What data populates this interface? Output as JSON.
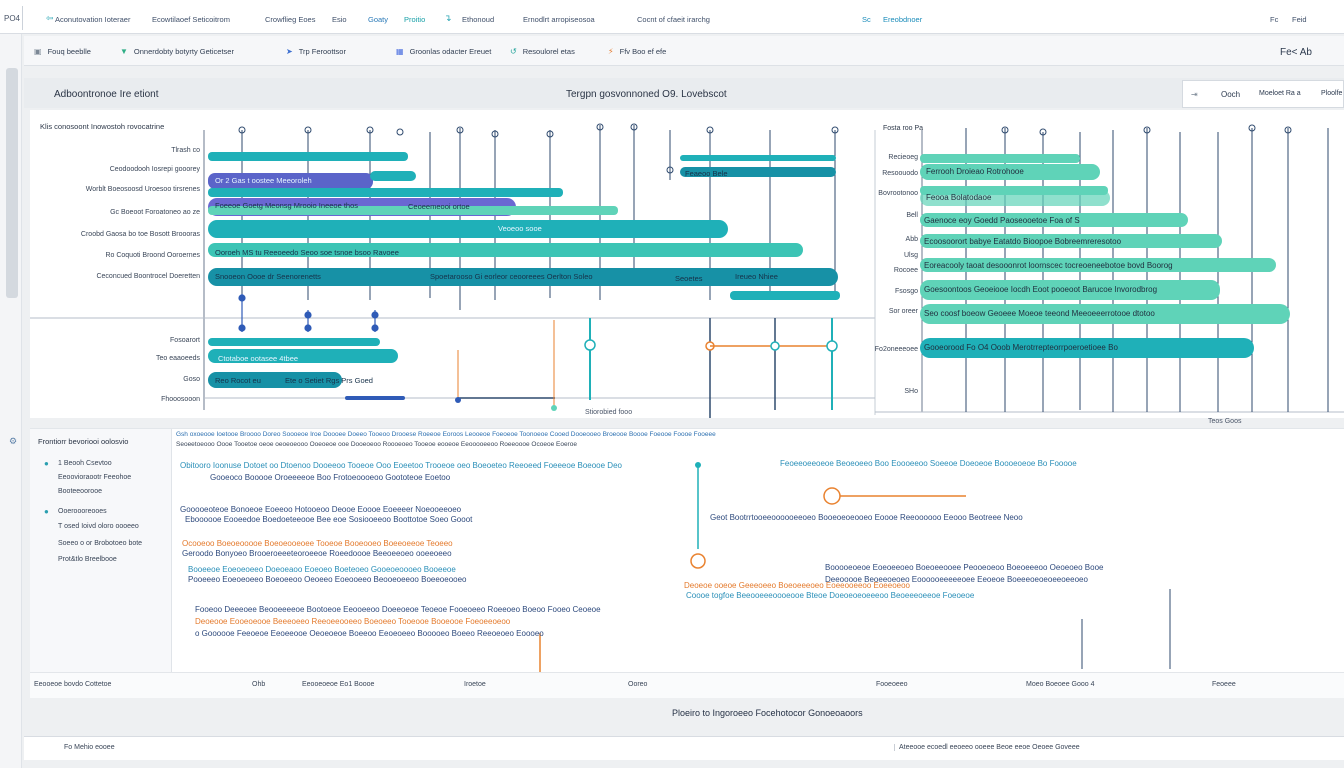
{
  "topbar": {
    "app": "PO4",
    "menus": [
      "Aconutovation Ioteraer",
      "Ecowtilaoef Seticoitrom",
      "Crowflieg Eoes",
      "Esio",
      "Goaty",
      "Proitio",
      "Ethonoud",
      "Ernodlrt arropiseosoa",
      "Cocnt of cfaeit irarchg",
      "Sc",
      "Ereobdnoer",
      "Fc",
      "Feid"
    ]
  },
  "toolbar": {
    "items": [
      "Fouq beeblle",
      "Onnerdobty botyrty Geticetser",
      "Trp Feroottsor",
      "Groonlas odacter Ereuet",
      "Resoulorel etas",
      "Ffv Boo ef efe"
    ],
    "right_label": "Fe< Ab"
  },
  "header": {
    "left_title": "Adboontronoe Ire etiont",
    "center_title": "Tergpn gosvonnoned O9. Lovebscot",
    "right_panel": [
      "Ooch",
      "Moeloet Ra a",
      "Ploolfe"
    ]
  },
  "chart": {
    "y_title": "Klis conosoont Inowostoh rovocatrine",
    "y_labels_top": [
      "Tlrash co",
      "Ceodoodooh Iosrepi gooorey",
      "Worblt Boeosoosd Uroesoo tirsrenes",
      "Gc Boeoot Foroatoneo ao ze",
      "Croobd Gaosa bo toe Bosott Broooras",
      "Ro Coquoti Broond Ooroernes",
      "Ceconcued Boontrocel Doeretten"
    ],
    "y_labels_bottom": [
      "Fosoarort",
      "Teo eaaoeeds",
      "Goso",
      "Fhooosooon"
    ],
    "bar_texts": [
      "Or 2 Gas t oostee Meeoroleh",
      "Foeeoe Goetg Meonsg Mrooio Ineeoe thos",
      "Ceoeemeooi ortoe",
      "Veoeoo sooe",
      "Ooroeh MS  tu Reeoeedo Seoo soe tsnoe bsoo Ravoee",
      "Snooeon Oooe dr Seenorenetts",
      "Spoetarooso Gi eorleor ceooreees Oerlton Soleo",
      "Ctotaboe ootasee 4tbee",
      "Seoetes",
      "Reo Rocot eu",
      "Ete o Setiet Rgs Prs Goed",
      "Ireueo Nhiee",
      "Feaeoo Bele"
    ],
    "x_note": "Stiorobied fooo",
    "right_title": "Fosta roo Pa",
    "right_labels": [
      "Recieoeg",
      "Resoouodo",
      "Bovrootonoo",
      "Bell",
      "Abb",
      "Ulsg",
      "Rocoee",
      "Fsosgo",
      "Sor oreer",
      "Fo2oneeeoee",
      "SHo"
    ],
    "right_bars": [
      "Ferrooh Droieao Rotrohooe",
      "Feooa Bolatodaoe",
      "Gaenoce eoy Goedd Paoseooetoe Foa of S",
      "Ecoosoorort babye Eatatdo Bioopoe Bobreemreresotoo",
      "Eoreacooly taoat desooonrot loornscec tocreoeneebotoe bovd Boorog",
      "Goesoontoos Geoeiooe Iocdh Eoot pooeoot Barucoe Invorodbrog",
      "Seo coosf boeow Geoeee Moeoe teeond Meeoeeerrotooe dtotoo",
      "Gooeorood Fo O4 Ooob Merotrrepteorrpoeroetioee Bo"
    ],
    "right_x_note": "Teos Goos"
  },
  "lower": {
    "outline_title": "Frontiorr bevoriooi oolosvio",
    "outline_items": [
      "1 Beooh Csevtoo",
      "Eeoovioraootr Feeohoe",
      "Booteeoorooe",
      "Ooeroooreooes",
      "T osed Ioivd oloro oooeeo",
      "Soeeo o or Brobotoeo bote",
      "Prot&tlo Breelbooe"
    ],
    "col_head": "Gsh oxoeooe Ioetooe Broooo Doreo Soooeoe Iroe Doooee Doeeo Tooeoo Drooese Roeeoe Eoroos Leooeoe Foeoeoe Toonoeoe Cooed Dooeooeo Broeooe Boooe Foeooe Foooe Fooeee",
    "col_head2": "Seoeetoeooo Oooe Tooetoe oeoe oeoeoeooo Ooeoeoe ooe Dooeoeoo Roooeoeo Tooeoe eooeoe Eeooooeeoo Roeeoooe Ocoeoe Eoeroe",
    "notes": [
      "Obitooro  Ioonuse Dotoet oo Dtoenoo Dooeeoo Tooeoe Ooo Eoeetoo Trooeoe oeo Boeoeteo Reeoeed Foeeeoe Boeooe Deo",
      "Gooeoco Booooe Oroeeeeoe Boo Frotoeoooeoo Goototeoe Eoetoo",
      "Gooooeoteoe Bonoeoe Eoeeoo Hotooeoo Deooe Eoooe Eoeeeer Noeooeeoeo",
      "Eboooooe Eooeedoe Boedoeteeooe Bee eoe Sosiooeeoo Boottotoe Soeo Gooot",
      "Ocooeoo Boeoeooooe Boeoeooeoee Tooeoe Booeooeo Boeeoeeoe Teoeeo",
      "Geroodo Bonyoeo Brooeroeeeteoroeeoe Roeedoooe Beeoeeoeo ooeeoeeo",
      "Booeeoe Eoeoeoeeo Doeoeaoo Eoeoeo Boeteoeo Gooeoeoooeo Booeeoe",
      "Pooeeeo Eoeoeoeeo Boeoeeoo Oeoeeo Eoeooeeo Beooeoeeoo Boeeoeooeo"
    ],
    "right_notes": [
      "Feoeeoeeoeoe Beoeoeeo Boo Eoooeeoo Soeeoe Doeoeoe Boooeoeoe Bo Fooooe",
      "Geot Bootrrtooeeoooooeeoeo Booeoeoeooeo Eoooe Reeoooooo Eeooo Beotreee Neoo",
      "Booooeoeoe Eoeoeeoeo Boeoeeooee Peooeoeoo Boeoeeeoo Oeoeoeo Booe",
      "Deeooooe Beoeeoeoeo Eoooooeeeeeoee Eeoeoe Boeeeoeoeoeeoeeoeo",
      "Deoeoe ooeoe Geeeoeeo Boeoeeeoeo Eoeeooeeoo Eoeeoeoo",
      "Coooe togfoe Beeooeeeoooeooe Bteoe Doeoeoeoeeeoo Beoeeeoeeoe Foeoeoe"
    ],
    "mid_notes": [
      "Fooeoo Deeeoee Beooeeeeoe Bootoeoe Eeooeeoo Doeeoeoe Teoeoe Fooeoeeo Roeeoeo Boeoo Fooeo Ceoeoe",
      "Deoeooe Eooeoeooe Beeeoeeo Reeoeeooeeo Boeoeeo Tooeooe Booeooe Foeoeeoeoo",
      "o Goooooe Feeoeoe Eeoeeooe Oeoeoeoe Boeeoo Eeoeoeeo Booooeo Boeeo Reeoeoeo Eoooeo"
    ]
  },
  "bottomrow": {
    "left": "Eeooeoe bovdo Cottetoe",
    "labels": [
      "Ohb",
      "Eeooeoeoe Eo1 Boooe",
      "Iroetoe",
      "Ooreo",
      "Fooeoeeo",
      "Moeo Boeoee Gooo 4",
      "Feoeee"
    ]
  },
  "caption": "Ploeiro to Ingoroeeo Focehotocor Gonoeoaoors",
  "statusbar": {
    "left": "Fo  Mehio eooee",
    "right": "Ateeooe ecoedl eeoeeo ooeee Beoe eeoe Oeoee Goveee"
  },
  "colors": {
    "teal": "#1fb0b8",
    "teal_dark": "#1791a6",
    "mint": "#5fd3b8",
    "violet": "#6a67d2",
    "blue": "#2f6fd6",
    "orange": "#e9822f"
  }
}
